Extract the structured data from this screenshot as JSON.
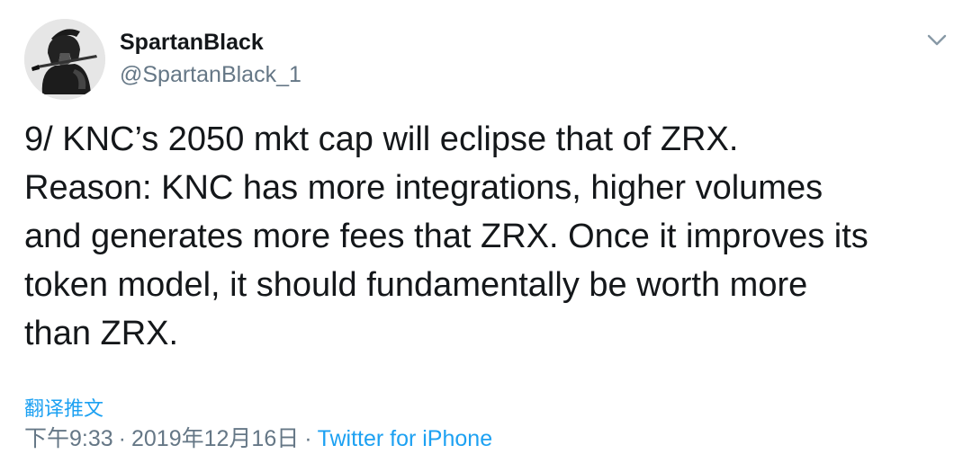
{
  "author": {
    "display_name": "SpartanBlack",
    "handle": "@SpartanBlack_1",
    "avatar_icon": "spartan-warrior-avatar"
  },
  "menu_icon": "chevron-down-icon",
  "tweet": {
    "text": "9/ KNC’s 2050 mkt cap will eclipse that of ZRX.\nReason: KNC has more integrations, higher volumes\nand generates more fees that ZRX. Once it improves its\ntoken model, it should fundamentally be worth more\nthan ZRX."
  },
  "translate_label": "翻译推文",
  "meta": {
    "time": "下午9:33",
    "separator": "·",
    "date": "2019年12月16日",
    "source": "Twitter for iPhone"
  },
  "colors": {
    "text": "#14171a",
    "secondary": "#657786",
    "link": "#1da1f2"
  }
}
